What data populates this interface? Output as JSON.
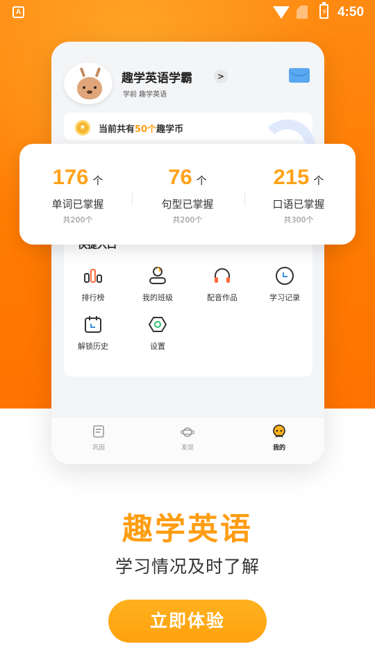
{
  "status_bar": {
    "time": "4:50",
    "notification_icon": "A",
    "icons": [
      "notification-icon",
      "wifi-icon",
      "no-sim-icon",
      "battery-charging-icon"
    ]
  },
  "profile": {
    "name": "趣学英语学霸",
    "subtitle": "学前  趣学英语",
    "chevron": ">"
  },
  "coins": {
    "prefix": "当前共有",
    "amount": "50个",
    "suffix": "趣学币"
  },
  "stats": [
    {
      "value": "176",
      "unit": "个",
      "label": "单词已掌握",
      "total": "共200个"
    },
    {
      "value": "76",
      "unit": "个",
      "label": "句型已掌握",
      "total": "共200个"
    },
    {
      "value": "215",
      "unit": "个",
      "label": "口语已掌握",
      "total": "共300个"
    }
  ],
  "shortcuts": {
    "title": "快捷入口",
    "items": [
      {
        "label": "排行榜",
        "icon": "ranking-icon"
      },
      {
        "label": "我的班级",
        "icon": "class-icon"
      },
      {
        "label": "配音作品",
        "icon": "headphones-icon"
      },
      {
        "label": "学习记录",
        "icon": "clock-icon"
      },
      {
        "label": "解锁历史",
        "icon": "calendar-icon"
      },
      {
        "label": "设置",
        "icon": "settings-icon"
      }
    ]
  },
  "tabs": [
    {
      "label": "巩固",
      "icon": "book-icon",
      "active": false
    },
    {
      "label": "发现",
      "icon": "planet-icon",
      "active": false
    },
    {
      "label": "我的",
      "icon": "profile-face-icon",
      "active": true
    }
  ],
  "headline": "趣学英语",
  "subline": "学习情况及时了解",
  "cta": "立即体验",
  "colors": {
    "accent": "#ff9d12",
    "hero": "#ff7a00",
    "stat_number": "#ffa21a"
  }
}
